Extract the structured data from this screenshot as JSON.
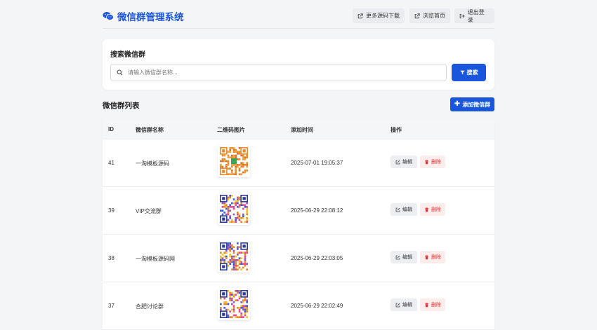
{
  "header": {
    "title": "微信群管理系统",
    "buttons": {
      "download": "更多源码下载",
      "home": "浏览首页",
      "logout": "退出登录"
    }
  },
  "search": {
    "title": "搜索微信群",
    "placeholder": "请输入微信群名称...",
    "value": "",
    "button_label": "搜索"
  },
  "list": {
    "title": "微信群列表",
    "add_button": "添加微信群",
    "columns": [
      "ID",
      "微信群名称",
      "二维码图片",
      "添加时间",
      "操作"
    ],
    "rows": [
      {
        "id": "41",
        "name": "一淘模板源码",
        "time": "2025-07-01 19:05:37",
        "qr_style": "orange"
      },
      {
        "id": "39",
        "name": "VIP交流群",
        "time": "2025-06-29 22:08:12",
        "qr_style": "multicolor"
      },
      {
        "id": "38",
        "name": "一淘模板源码网",
        "time": "2025-06-29 22:03:05",
        "qr_style": "multicolor"
      },
      {
        "id": "37",
        "name": "合肥讨论群",
        "time": "2025-06-29 22:02:49",
        "qr_style": "multicolor"
      }
    ],
    "edit_label": "编辑",
    "delete_label": "删除"
  },
  "colors": {
    "primary": "#1a56db",
    "danger": "#e03131",
    "background": "#f4f5f7"
  },
  "icons": {
    "brand": "wechat-icon",
    "external": "external-link-icon",
    "logout": "sign-out-icon",
    "search": "search-icon",
    "filter": "filter-icon",
    "plus": "plus-icon",
    "edit": "edit-icon",
    "delete": "trash-icon"
  }
}
